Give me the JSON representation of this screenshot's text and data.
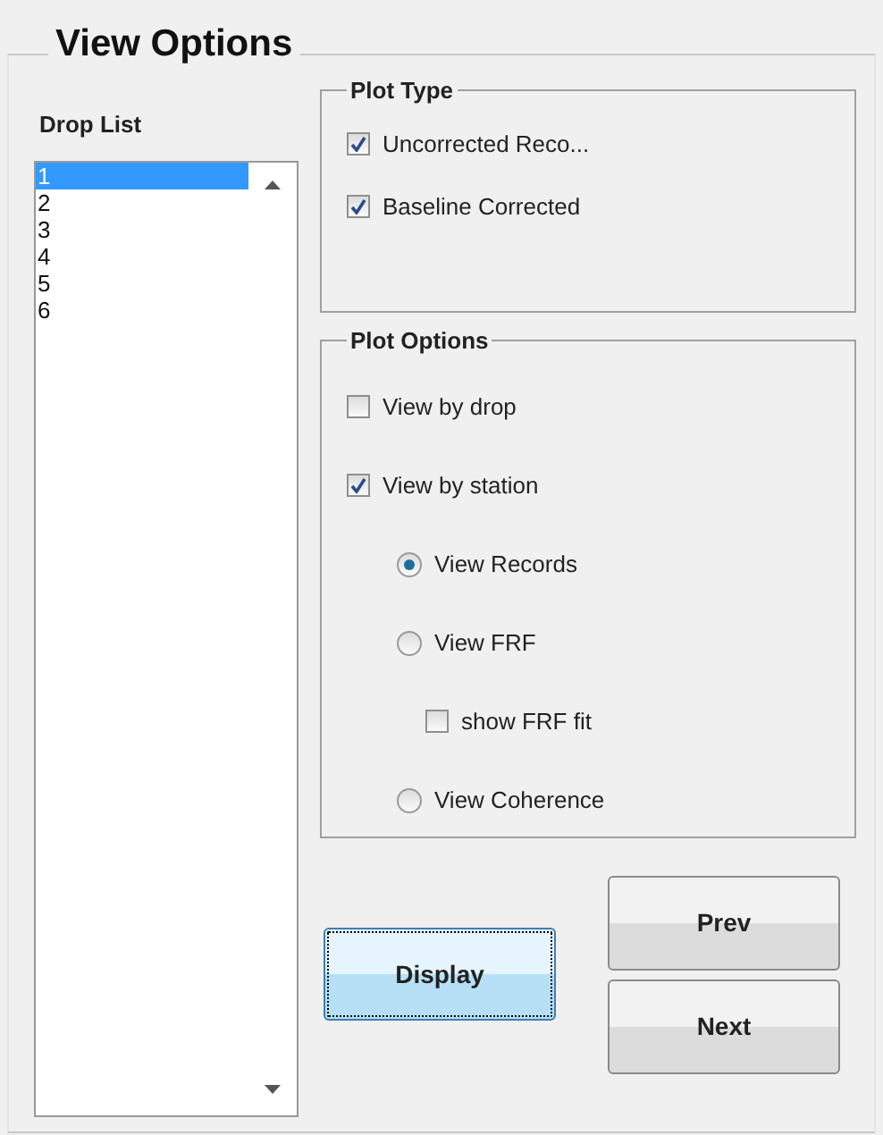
{
  "panel": {
    "title": "View Options"
  },
  "drop_list": {
    "label": "Drop List",
    "items": [
      {
        "label": "1",
        "selected": true
      },
      {
        "label": "2",
        "selected": false
      },
      {
        "label": "3",
        "selected": false
      },
      {
        "label": "4",
        "selected": false
      },
      {
        "label": "5",
        "selected": false
      },
      {
        "label": "6",
        "selected": false
      }
    ]
  },
  "plot_type": {
    "title": "Plot Type",
    "items": [
      {
        "kind": "checkbox",
        "label": "Uncorrected Reco...",
        "checked": true
      },
      {
        "kind": "checkbox",
        "label": "Baseline Corrected",
        "checked": true
      }
    ]
  },
  "plot_options": {
    "title": "Plot Options",
    "items": [
      {
        "kind": "checkbox",
        "label": "View by drop",
        "checked": false
      },
      {
        "kind": "checkbox",
        "label": "View by station",
        "checked": true,
        "children": [
          {
            "kind": "radio",
            "label": "View Records",
            "selected": true
          },
          {
            "kind": "radio",
            "label": "View FRF",
            "selected": false,
            "children": [
              {
                "kind": "checkbox",
                "label": "show FRF fit",
                "checked": false
              }
            ]
          },
          {
            "kind": "radio",
            "label": "View Coherence",
            "selected": false
          }
        ]
      }
    ]
  },
  "buttons": [
    {
      "label": "Display",
      "focused": true
    },
    {
      "label": "Prev",
      "focused": false
    },
    {
      "label": "Next",
      "focused": false
    }
  ]
}
